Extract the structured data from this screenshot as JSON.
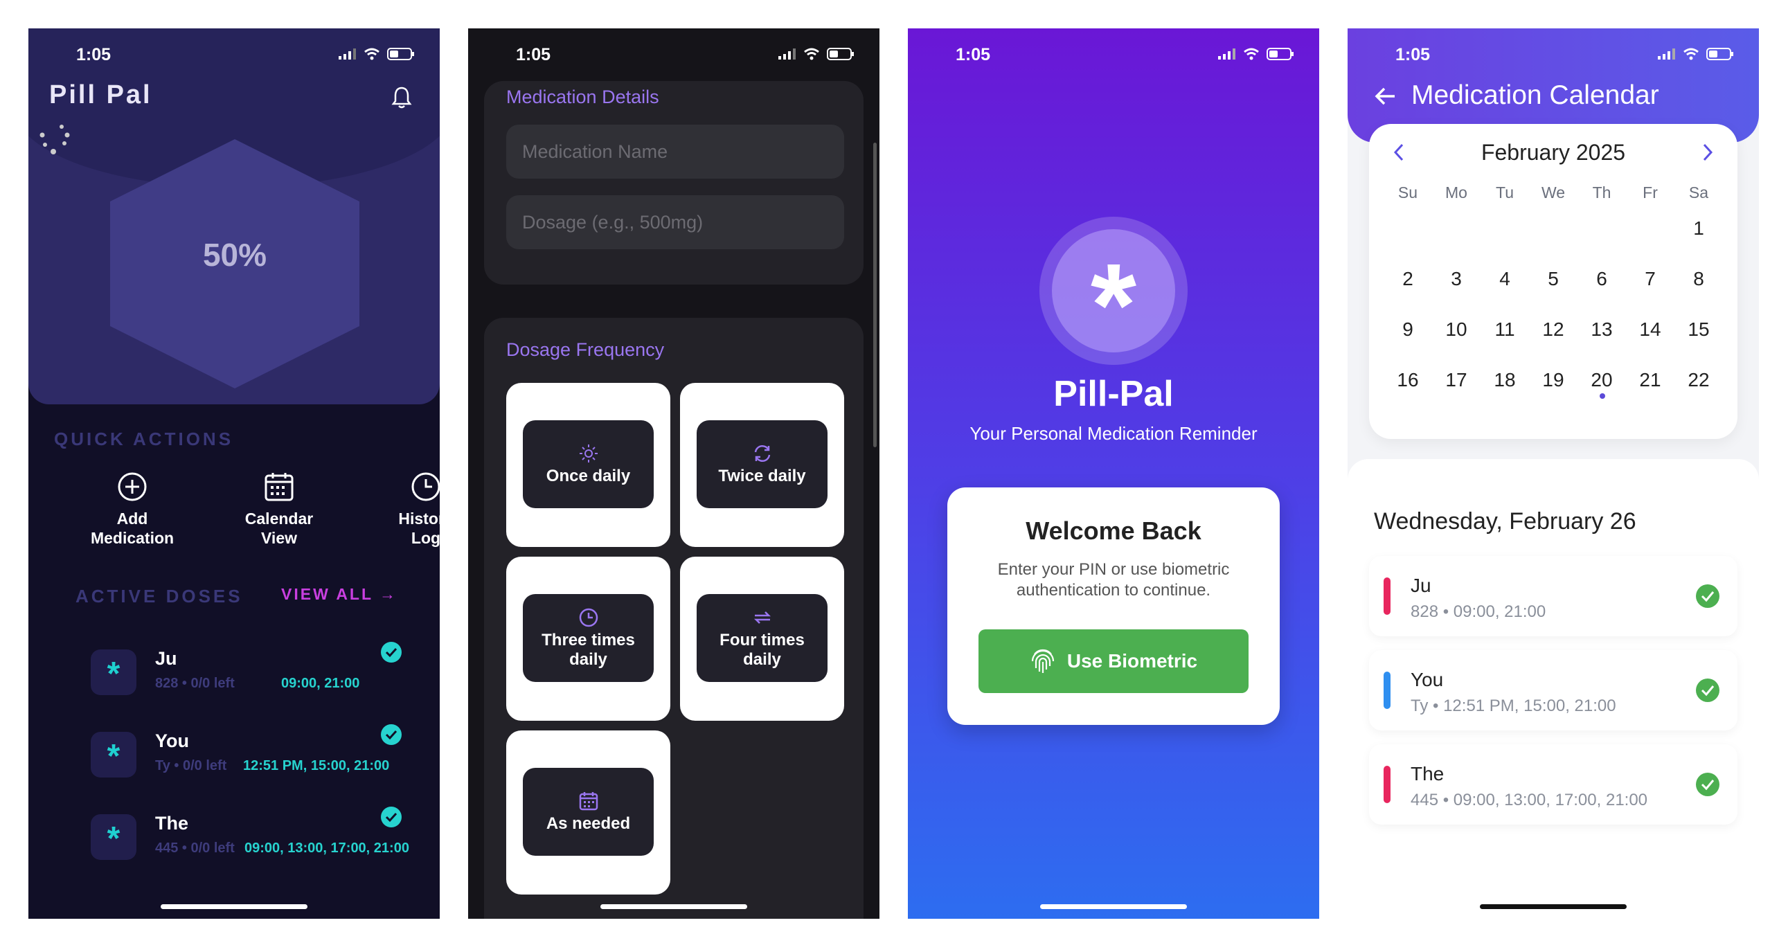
{
  "status": {
    "time": "1:05"
  },
  "screen1": {
    "title": "Pill Pal",
    "progress_percent": "50%",
    "quick_actions_title": "QUICK ACTIONS",
    "quick_actions": [
      {
        "label": "Add\nMedication",
        "icon": "plus-circle-icon"
      },
      {
        "label": "Calendar\nView",
        "icon": "calendar-icon"
      },
      {
        "label": "History\nLog",
        "icon": "clock-icon"
      }
    ],
    "active_doses_title": "ACTIVE DOSES",
    "view_all": "VIEW ALL →",
    "doses": [
      {
        "name": "Ju",
        "sub": "828 • 0/0 left",
        "times": "09:00, 21:00"
      },
      {
        "name": "You",
        "sub": "Ty • 0/0 left",
        "times": "12:51 PM, 15:00, 21:00"
      },
      {
        "name": "The",
        "sub": "445 • 0/0 left",
        "times": "09:00, 13:00, 17:00, 21:00"
      }
    ],
    "colors": {
      "accent": "#27d3cf",
      "view_all": "#c93fe0"
    }
  },
  "screen2": {
    "details_title": "Medication Details",
    "name_placeholder": "Medication Name",
    "dosage_placeholder": "Dosage (e.g., 500mg)",
    "frequency_title": "Dosage Frequency",
    "options": [
      {
        "label": "Once daily",
        "icon": "sun-icon"
      },
      {
        "label": "Twice daily",
        "icon": "refresh-icon"
      },
      {
        "label": "Three times daily",
        "icon": "clock-icon"
      },
      {
        "label": "Four times daily",
        "icon": "repeat-icon"
      },
      {
        "label": "As needed",
        "icon": "calendar-icon"
      }
    ]
  },
  "screen3": {
    "app_name": "Pill-Pal",
    "tagline": "Your Personal Medication Reminder",
    "welcome_title": "Welcome Back",
    "welcome_text": "Enter your PIN or use biometric authentication to continue.",
    "biometric_button": "Use Biometric"
  },
  "screen4": {
    "title": "Medication Calendar",
    "month": "February 2025",
    "weekdays": [
      "Su",
      "Mo",
      "Tu",
      "We",
      "Th",
      "Fr",
      "Sa"
    ],
    "weeks": [
      [
        "",
        "",
        "",
        "",
        "",
        "",
        "1"
      ],
      [
        "2",
        "3",
        "4",
        "5",
        "6",
        "7",
        "8"
      ],
      [
        "9",
        "10",
        "11",
        "12",
        "13",
        "14",
        "15"
      ],
      [
        "16",
        "17",
        "18",
        "19",
        "20",
        "21",
        "22"
      ]
    ],
    "marked_day": "20",
    "day_title": "Wednesday, February 26",
    "meds": [
      {
        "name": "Ju",
        "sub": "828 • 09:00, 21:00",
        "color": "#e8265e"
      },
      {
        "name": "You",
        "sub": "Ty • 12:51 PM, 15:00, 21:00",
        "color": "#2f8ff0"
      },
      {
        "name": "The",
        "sub": "445 • 09:00, 13:00, 17:00, 21:00",
        "color": "#e8265e"
      }
    ],
    "colors": {
      "header": "#5b4fe4",
      "check": "#4caf50"
    }
  }
}
